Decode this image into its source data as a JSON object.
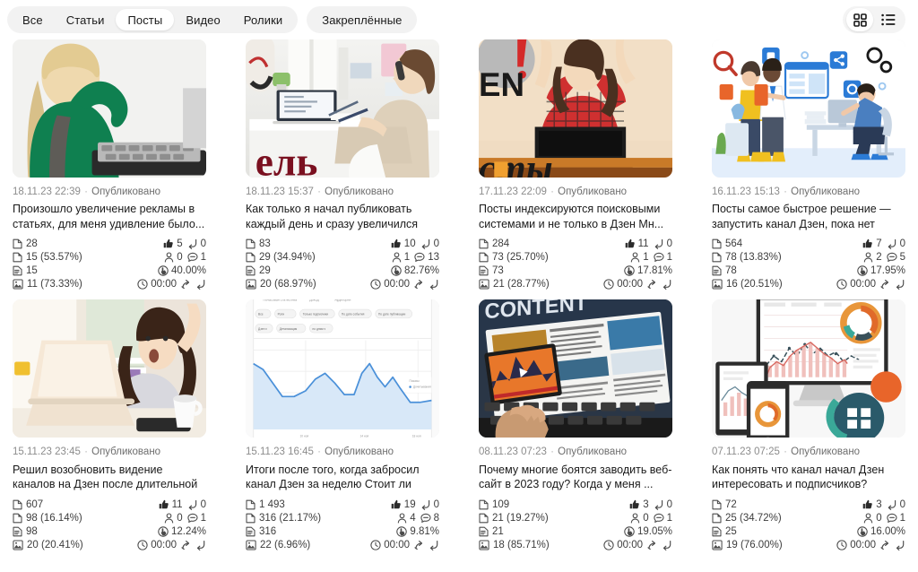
{
  "topbar": {
    "primary_filters": [
      {
        "label": "Все",
        "active": false
      },
      {
        "label": "Статьи",
        "active": false
      },
      {
        "label": "Посты",
        "active": true
      },
      {
        "label": "Видео",
        "active": false
      },
      {
        "label": "Ролики",
        "active": false
      }
    ],
    "secondary_filters": [
      {
        "label": "Закреплённые",
        "active": false
      }
    ],
    "view_modes": [
      {
        "name": "grid-view",
        "icon": "grid-icon",
        "active": true
      },
      {
        "name": "list-view",
        "icon": "list-icon",
        "active": false
      }
    ],
    "colors": {
      "chip_group_bg": "#f2f2f2",
      "chip_active_bg": "#ffffff",
      "text": "#1a1a1a"
    }
  },
  "icon_labels": {
    "shows": "page-icon",
    "views": "page-filled-icon",
    "reads": "document-lines-icon",
    "read_through": "image-icon",
    "likes": "thumbs-up-icon",
    "dislikes": "reply-arrow-icon",
    "subscribers": "person-icon",
    "comments": "comment-icon",
    "engagement": "click-hand-icon",
    "time": "clock-icon",
    "share": "share-icon",
    "repost": "repost-icon"
  },
  "cards": [
    {
      "thumb": "woman-green-sweater-keyboard",
      "date": "18.11.23 22:39",
      "status": "Опубликовано",
      "title": "Произошло увеличение рекламы в статьях, для меня удивление было...",
      "shows": "28",
      "views": "15 (53.57%)",
      "reads": "15",
      "read_through": "11 (73.33%)",
      "likes": "5",
      "dislikes": "0",
      "subscribers": "0",
      "comments": "1",
      "engagement": "40.00%",
      "time": "00:00"
    },
    {
      "thumb": "woman-phone-desk-laptop",
      "date": "18.11.23 15:37",
      "status": "Опубликовано",
      "title": "Как только я начал публиковать каждый день и сразу увеличился до...",
      "shows": "83",
      "views": "29 (34.94%)",
      "reads": "29",
      "read_through": "20 (68.97%)",
      "likes": "10",
      "dislikes": "0",
      "subscribers": "1",
      "comments": "13",
      "engagement": "82.76%",
      "time": "00:00"
    },
    {
      "thumb": "woman-arms-up-laptop-sofa",
      "date": "17.11.23 22:09",
      "status": "Опубликовано",
      "title": "Посты индексируются поисковыми системами и не только в Дзен Мн...",
      "shows": "284",
      "views": "73 (25.70%)",
      "reads": "73",
      "read_through": "21 (28.77%)",
      "likes": "11",
      "dislikes": "0",
      "subscribers": "1",
      "comments": "1",
      "engagement": "17.81%",
      "time": "00:00"
    },
    {
      "thumb": "flat-illustration-office-team",
      "date": "16.11.23 15:13",
      "status": "Опубликовано",
      "title": "Посты самое быстрое решение — запустить канал Дзен, пока нет иде...",
      "shows": "564",
      "views": "78 (13.83%)",
      "reads": "78",
      "read_through": "16 (20.51%)",
      "likes": "7",
      "dislikes": "0",
      "subscribers": "2",
      "comments": "5",
      "engagement": "17.95%",
      "time": "00:00"
    },
    {
      "thumb": "woman-surprised-laptop-coffee",
      "date": "15.11.23 23:45",
      "status": "Опубликовано",
      "title": "Решил возобновить видение каналов на Дзен после длительной пауз...",
      "shows": "607",
      "views": "98 (16.14%)",
      "reads": "98",
      "read_through": "20 (20.41%)",
      "likes": "11",
      "dislikes": "0",
      "subscribers": "0",
      "comments": "1",
      "engagement": "12.24%",
      "time": "00:00"
    },
    {
      "thumb": "dashboard-area-chart-screenshot",
      "date": "15.11.23 16:45",
      "status": "Опубликовано",
      "title": "Итоги после того, когда забросил канал Дзен за неделю Стоит ли вес...",
      "shows": "1 493",
      "views": "316 (21.17%)",
      "reads": "316",
      "read_through": "22 (6.96%)",
      "likes": "19",
      "dislikes": "0",
      "subscribers": "4",
      "comments": "8",
      "engagement": "9.81%",
      "time": "00:00"
    },
    {
      "thumb": "content-laptop-typing-hands",
      "date": "08.11.23 07:23",
      "status": "Опубликовано",
      "title": "Почему многие боятся заводить веб-сайт в 2023 году? Когда у меня ...",
      "shows": "109",
      "views": "21 (19.27%)",
      "reads": "21",
      "read_through": "18 (85.71%)",
      "likes": "3",
      "dislikes": "0",
      "subscribers": "0",
      "comments": "1",
      "engagement": "19.05%",
      "time": "00:00"
    },
    {
      "thumb": "devices-analytics-charts",
      "date": "07.11.23 07:25",
      "status": "Опубликовано",
      "title": "Как понять что канал начал Дзен интересовать и подписчиков? Миног...",
      "shows": "72",
      "views": "25 (34.72%)",
      "reads": "25",
      "read_through": "19 (76.00%)",
      "likes": "3",
      "dislikes": "0",
      "subscribers": "0",
      "comments": "1",
      "engagement": "16.00%",
      "time": "00:00"
    }
  ]
}
